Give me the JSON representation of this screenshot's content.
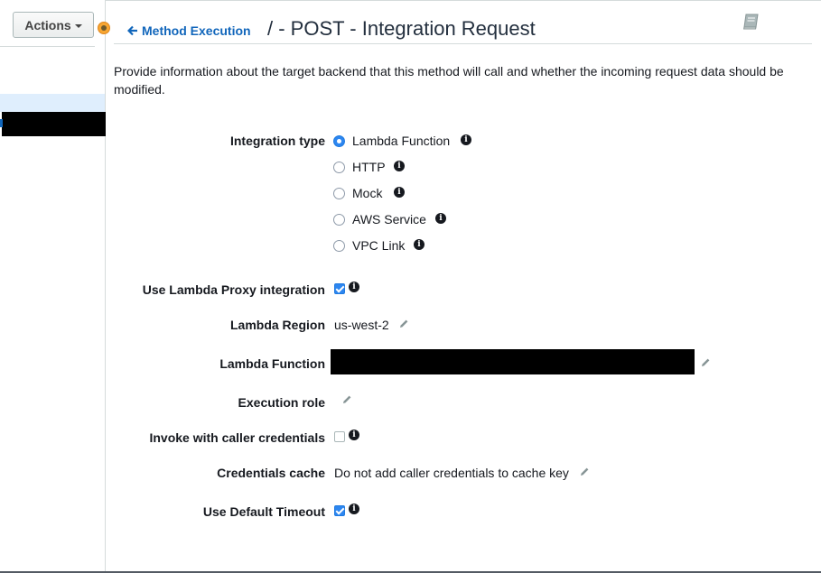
{
  "toolbar": {
    "actions_label": "Actions"
  },
  "header": {
    "back_link_label": "Method Execution",
    "title": "/ - POST - Integration Request"
  },
  "description": "Provide information about the target backend that this method will call and whether the incoming request data should be modified.",
  "form": {
    "integration_type": {
      "label": "Integration type",
      "options": [
        {
          "label": "Lambda Function",
          "selected": true
        },
        {
          "label": "HTTP",
          "selected": false
        },
        {
          "label": "Mock",
          "selected": false
        },
        {
          "label": "AWS Service",
          "selected": false
        },
        {
          "label": "VPC Link",
          "selected": false
        }
      ]
    },
    "lambda_proxy": {
      "label": "Use Lambda Proxy integration",
      "checked": true
    },
    "lambda_region": {
      "label": "Lambda Region",
      "value": "us-west-2"
    },
    "lambda_function": {
      "label": "Lambda Function"
    },
    "execution_role": {
      "label": "Execution role"
    },
    "invoke_caller_credentials": {
      "label": "Invoke with caller credentials",
      "checked": false
    },
    "credentials_cache": {
      "label": "Credentials cache",
      "value": "Do not add caller credentials to cache key"
    },
    "default_timeout": {
      "label": "Use Default Timeout",
      "checked": true
    }
  },
  "icons": {
    "info": "info-icon",
    "edit": "pencil-icon",
    "back": "arrow-left-icon",
    "docs": "book-icon",
    "resource": "resource-dot-icon"
  },
  "colors": {
    "link": "#1166bb",
    "accent": "#2d86f0",
    "selected_row": "#dfeefd"
  }
}
